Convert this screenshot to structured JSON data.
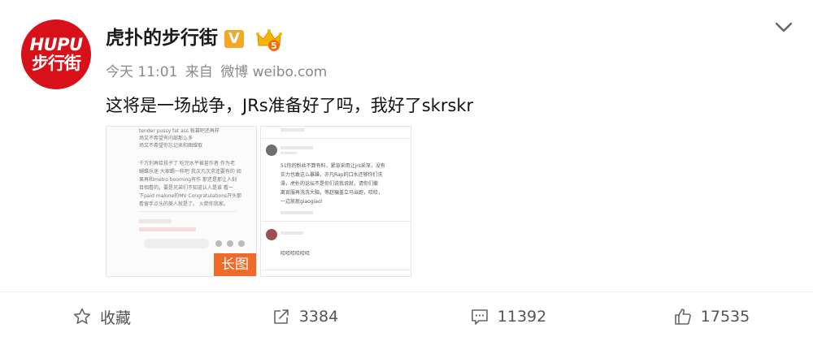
{
  "account": {
    "avatar_line1": "HUPU",
    "avatar_line2": "步行街",
    "name": "虎扑的步行街",
    "verified_badge": "V",
    "level_badge": "5",
    "brand_color": "#d8101a"
  },
  "post": {
    "time": "今天 11:01",
    "source_prefix": "来自",
    "source": "微博 weibo.com",
    "text": "这将是一场战争，JRs准备好了吗，我好了skrskr"
  },
  "images": {
    "long_badge": "长图",
    "image1_lines": [
      "tender pussy fat ass 帐幕吧还再样",
      "场又不希望有内部那么多",
      "场又不希望你忘记来和图维取",
      "",
      "千万别再给孩子了 吃完水平被甚作者 作为老",
      "蝴蝶乐迷 大家踢一样吧 我次凡次求还要有的 如",
      "果再和metro booming有作 那还是那让人刻",
      "目相看的，要是兄弟们不知道认人是谁 看一",
      "下paid malone的MV Congratulations开头那",
      "看留手点头的美人就是了。 火箭你我家。"
    ],
    "image2_comments": [
      "51你的粉丝不算有料，紧急采用让jrs采深，没有",
      "实力也敢这么暴躁，亦凡Rap的口水还够你们洗",
      "澡，虎扑的论坛不是你们说我说就，请你们撤",
      "离官服再洗洗大脑，等赵骗盖立马当跑，哈哈，",
      "一边放屁giaogiao!"
    ],
    "image2_reply": "哈哈哈哈哈哈"
  },
  "actions": {
    "favorite_label": "收藏",
    "repost_count": "3384",
    "comment_count": "11392",
    "like_count": "17535"
  }
}
